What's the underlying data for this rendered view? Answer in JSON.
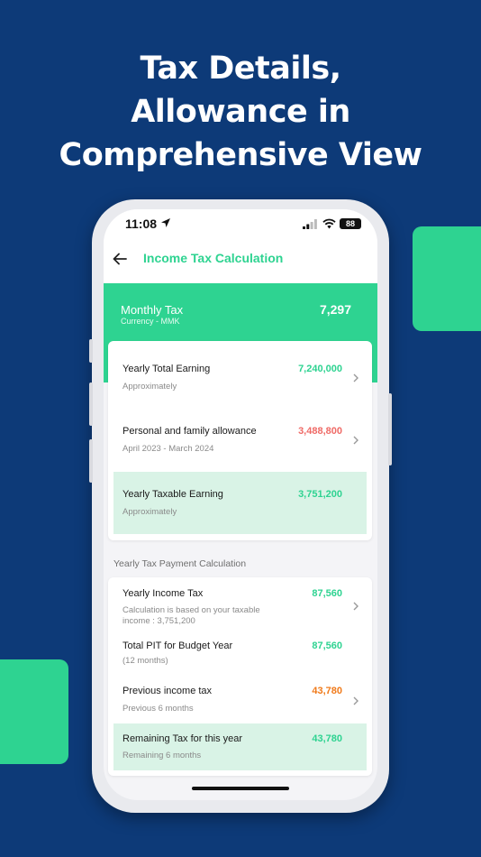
{
  "headline": {
    "line1": "Tax Details,",
    "line2": "Allowance in",
    "line3": "Comprehensive View"
  },
  "status_bar": {
    "time": "11:08",
    "battery": "88"
  },
  "app_bar": {
    "title": "Income Tax Calculation",
    "back_icon": "arrow-left-icon"
  },
  "summary": {
    "label": "Monthly Tax",
    "currency": "Currency - MMK",
    "value": "7,297"
  },
  "earnings": [
    {
      "label": "Yearly Total Earning",
      "sub": "Approximately",
      "value": "7,240,000",
      "value_color": "#2ed391"
    },
    {
      "label": "Personal and family allowance",
      "sub": "April 2023 - March 2024",
      "value": "3,488,800",
      "value_color": "#ef6a66"
    },
    {
      "label": "Yearly Taxable Earning",
      "sub": "Approximately",
      "value": "3,751,200",
      "value_color": "#2ed391"
    }
  ],
  "payment_section_title": "Yearly Tax Payment Calculation",
  "payments": [
    {
      "label": "Yearly Income Tax",
      "sub": "Calculation is based on your taxable income : 3,751,200",
      "value": "87,560"
    },
    {
      "label": "Total PIT for Budget Year",
      "sub": "(12 months)",
      "value": "87,560"
    },
    {
      "label": "Previous income tax",
      "sub": "Previous 6 months",
      "value": "43,780"
    },
    {
      "label": "Remaining Tax for this year",
      "sub": "Remaining 6 months",
      "value": "43,780"
    }
  ],
  "colors": {
    "background": "#0d3a78",
    "accent": "#2ed391",
    "highlight": "#d9f3e6",
    "negative": "#ef6a66",
    "warning": "#f07a1a"
  }
}
